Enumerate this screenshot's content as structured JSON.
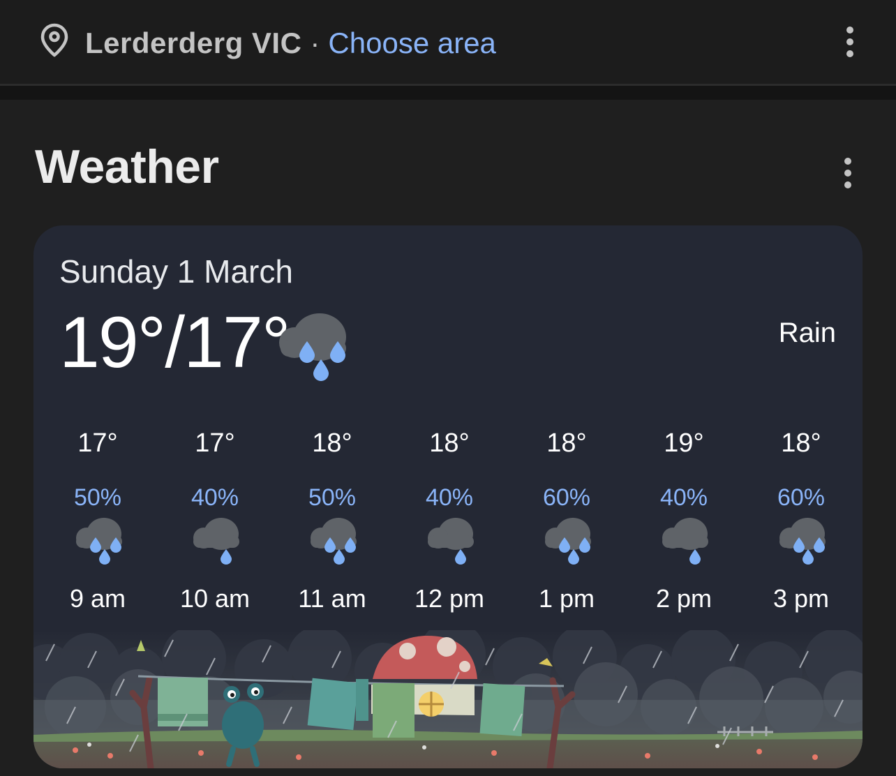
{
  "location": {
    "name": "Lerderderg VIC",
    "separator": "·",
    "choose_area": "Choose area"
  },
  "weather": {
    "heading": "Weather",
    "date": "Sunday 1 March",
    "temp": "19°/17°",
    "condition": "Rain",
    "hourly": [
      {
        "temp": "17°",
        "precip": "50%",
        "time": "9 am",
        "icon": "heavy-rain-icon"
      },
      {
        "temp": "17°",
        "precip": "40%",
        "time": "10 am",
        "icon": "light-rain-icon"
      },
      {
        "temp": "18°",
        "precip": "50%",
        "time": "11 am",
        "icon": "heavy-rain-icon"
      },
      {
        "temp": "18°",
        "precip": "40%",
        "time": "12 pm",
        "icon": "light-rain-icon"
      },
      {
        "temp": "18°",
        "precip": "60%",
        "time": "1 pm",
        "icon": "heavy-rain-icon"
      },
      {
        "temp": "19°",
        "precip": "40%",
        "time": "2 pm",
        "icon": "light-rain-icon"
      },
      {
        "temp": "18°",
        "precip": "60%",
        "time": "3 pm",
        "icon": "heavy-rain-icon"
      }
    ]
  },
  "icons": {
    "location": "map-pin-icon",
    "menu": "more-vert-icon",
    "current": "heavy-rain-icon",
    "illustration": "rainy-frog-illustration"
  },
  "colors": {
    "accent": "#8ab4f8",
    "card_bg": "#242834",
    "page_bg": "#1f1f1f",
    "rain_drop": "#7fb0f5",
    "cloud": "#5f6368"
  }
}
